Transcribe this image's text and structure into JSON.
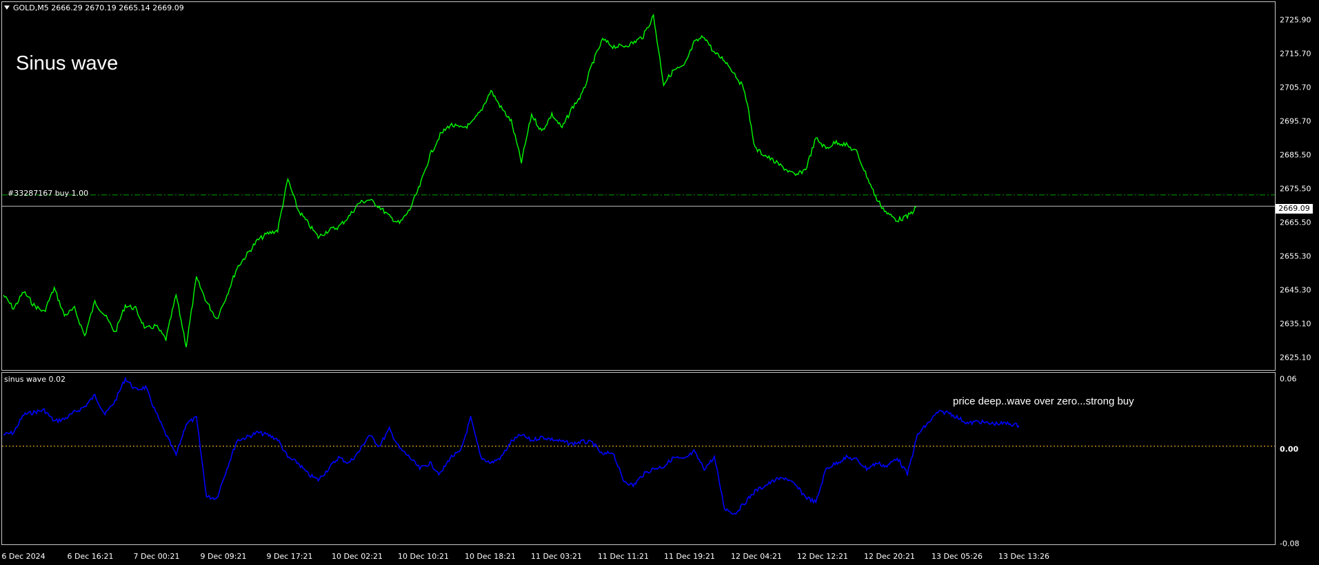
{
  "symbol_info": "GOLD,M5  2666.29 2670.19 2665.14 2669.09",
  "chart_title": "Sinus wave",
  "order_label": "#33287167 buy 1.00",
  "current_price": "2669.09",
  "indicator": {
    "title": "sinus wave 0.02",
    "note": "price deep..wave over zero...strong buy"
  },
  "colors": {
    "price_line": "#00ff00",
    "indicator_line": "#0000ff",
    "zero_line": "#daa520",
    "order_line": "#00a000",
    "background": "#000000"
  },
  "price_axis": [
    "2725.90",
    "2715.70",
    "2705.70",
    "2695.70",
    "2685.50",
    "2675.50",
    "2665.50",
    "2655.30",
    "2645.30",
    "2635.10",
    "2625.10"
  ],
  "indicator_axis": [
    "0.06",
    "0.00",
    "-0.08"
  ],
  "time_axis": [
    "6 Dec 2024",
    "6 Dec 16:21",
    "7 Dec 00:21",
    "9 Dec 09:21",
    "9 Dec 17:21",
    "10 Dec 02:21",
    "10 Dec 10:21",
    "10 Dec 18:21",
    "11 Dec 03:21",
    "11 Dec 11:21",
    "11 Dec 19:21",
    "12 Dec 04:21",
    "12 Dec 12:21",
    "12 Dec 20:21",
    "13 Dec 05:26",
    "13 Dec 13:26"
  ],
  "chart_data": {
    "type": "line",
    "price_series": {
      "x_index": [
        0,
        3,
        6,
        9,
        12,
        15,
        18,
        21,
        24,
        27,
        30,
        33,
        36,
        39,
        42,
        45,
        48,
        51,
        54,
        57,
        60,
        63,
        66,
        69,
        72,
        75,
        78,
        81,
        84,
        87,
        90,
        93,
        96,
        99,
        102,
        105,
        108,
        111,
        114,
        117,
        120,
        123,
        126,
        129,
        132,
        135,
        138,
        141,
        144,
        147,
        150,
        153,
        156,
        159,
        162,
        165,
        168,
        171,
        174,
        177,
        180,
        183,
        186,
        189,
        192,
        195,
        198,
        201,
        204,
        207,
        210,
        213,
        216,
        219,
        222,
        225,
        228,
        231,
        234,
        237,
        240,
        243,
        246,
        249,
        252,
        255,
        258,
        261,
        264,
        267,
        270,
        273,
        276,
        279,
        282,
        285,
        288,
        291,
        294,
        297,
        300
      ],
      "values": [
        2643,
        2639,
        2644,
        2640,
        2638,
        2645,
        2637,
        2639,
        2631,
        2641,
        2637,
        2632,
        2640,
        2639,
        2633,
        2634,
        2630,
        2643,
        2628,
        2648,
        2641,
        2636,
        2643,
        2651,
        2655,
        2659,
        2661,
        2662,
        2677,
        2668,
        2664,
        2660,
        2662,
        2663,
        2666,
        2670,
        2671,
        2669,
        2666,
        2664,
        2668,
        2675,
        2684,
        2690,
        2693,
        2692,
        2693,
        2697,
        2703,
        2698,
        2694,
        2682,
        2696,
        2691,
        2696,
        2692,
        2698,
        2702,
        2711,
        2718,
        2716,
        2716,
        2717,
        2719,
        2725,
        2705,
        2709,
        2710,
        2717,
        2719,
        2714,
        2712,
        2708,
        2703,
        2686,
        2684,
        2682,
        2680,
        2678,
        2680,
        2689,
        2686,
        2688,
        2687,
        2685,
        2678,
        2671,
        2667,
        2665,
        2666,
        2669
      ]
    },
    "indicator_series": {
      "x_index": [
        0,
        3,
        6,
        9,
        12,
        15,
        18,
        21,
        24,
        27,
        30,
        33,
        36,
        39,
        42,
        45,
        48,
        51,
        54,
        57,
        60,
        63,
        66,
        69,
        72,
        75,
        78,
        81,
        84,
        87,
        90,
        93,
        96,
        99,
        102,
        105,
        108,
        111,
        114,
        117,
        120,
        123,
        126,
        129,
        132,
        135,
        138,
        141,
        144,
        147,
        150,
        153,
        156,
        159,
        162,
        165,
        168,
        171,
        174,
        177,
        180,
        183,
        186,
        189,
        192,
        195,
        198,
        201,
        204,
        207,
        210,
        213,
        216,
        219,
        222,
        225,
        228,
        231,
        234,
        237,
        240,
        243,
        246,
        249,
        252,
        255,
        258,
        261,
        264,
        267,
        270,
        273,
        276,
        279,
        282,
        285,
        288,
        291,
        294,
        297,
        300
      ],
      "values": [
        0.01,
        0.012,
        0.028,
        0.03,
        0.032,
        0.022,
        0.024,
        0.03,
        0.035,
        0.045,
        0.028,
        0.04,
        0.06,
        0.05,
        0.052,
        0.03,
        0.01,
        -0.008,
        0.02,
        0.025,
        -0.045,
        -0.046,
        -0.02,
        0.005,
        0.008,
        0.012,
        0.01,
        0.006,
        -0.01,
        -0.015,
        -0.025,
        -0.03,
        -0.02,
        -0.01,
        -0.015,
        -0.005,
        0.01,
        0.0,
        0.015,
        -0.002,
        -0.01,
        -0.02,
        -0.015,
        -0.025,
        -0.01,
        -0.005,
        0.025,
        -0.01,
        -0.015,
        -0.01,
        0.004,
        0.01,
        0.005,
        0.008,
        0.006,
        0.004,
        0.002,
        0.004,
        0.003,
        -0.008,
        -0.005,
        -0.03,
        -0.035,
        -0.025,
        -0.02,
        -0.018,
        -0.01,
        -0.012,
        -0.005,
        -0.02,
        -0.01,
        -0.055,
        -0.06,
        -0.05,
        -0.04,
        -0.035,
        -0.03,
        -0.028,
        -0.035,
        -0.045,
        -0.05,
        -0.02,
        -0.015,
        -0.01,
        -0.012,
        -0.02,
        -0.015,
        -0.018,
        -0.01,
        -0.025,
        0.01,
        0.02,
        0.03,
        0.03,
        0.025,
        0.02,
        0.022,
        0.02,
        0.02,
        0.02,
        0.018
      ]
    },
    "order_price": 2672.4,
    "price_ylim": [
      2621.0,
      2729.0
    ],
    "indicator_ylim": [
      -0.087,
      0.065
    ],
    "zero_level": 0.0
  }
}
